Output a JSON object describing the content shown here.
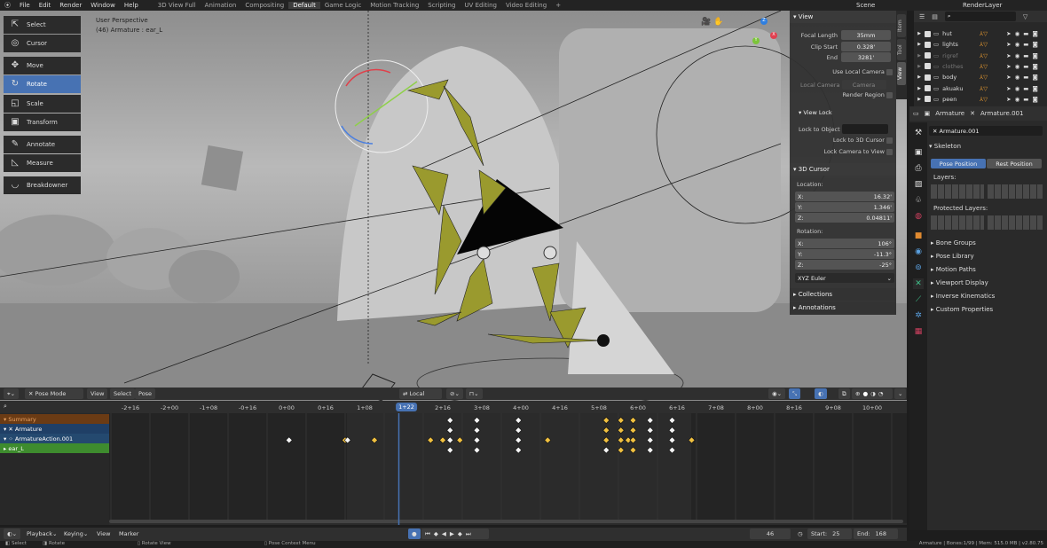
{
  "menu": {
    "items": [
      "File",
      "Edit",
      "Render",
      "Window",
      "Help"
    ],
    "workspaces": [
      "3D View Full",
      "Animation",
      "Compositing",
      "Default",
      "Game Logic",
      "Motion Tracking",
      "Scripting",
      "UV Editing",
      "Video Editing"
    ],
    "active_workspace": "Default",
    "add": "+",
    "scene": "Scene",
    "render_layer": "RenderLayer"
  },
  "toolbar": {
    "tools": [
      {
        "label": "Select",
        "icon": "select-icon"
      },
      {
        "label": "Cursor",
        "icon": "cursor-icon"
      },
      {
        "label": "Move",
        "icon": "move-icon"
      },
      {
        "label": "Rotate",
        "icon": "rotate-icon",
        "active": true
      },
      {
        "label": "Scale",
        "icon": "scale-icon"
      },
      {
        "label": "Transform",
        "icon": "transform-icon"
      },
      {
        "label": "Annotate",
        "icon": "annotate-icon"
      },
      {
        "label": "Measure",
        "icon": "measure-icon"
      },
      {
        "label": "Breakdowner",
        "icon": "breakdowner-icon"
      }
    ]
  },
  "viewport": {
    "perspective": "User Perspective",
    "object": "(46) Armature : ear_L",
    "gizmo": {
      "x": "X",
      "y": "Y",
      "z": "Z"
    }
  },
  "npanel": {
    "tabs": [
      "Item",
      "Tool",
      "View"
    ],
    "active_tab": "View",
    "view": {
      "title": "View",
      "focal_length_label": "Focal Length",
      "focal_length": "35mm",
      "clip_start_label": "Clip Start",
      "clip_start": "0.328'",
      "end_label": "End",
      "end": "3281'",
      "use_local_camera": "Use Local Camera",
      "local_camera_label": "Local Camera",
      "local_camera": "Camera",
      "render_region": "Render Region"
    },
    "view_lock": {
      "title": "View Lock",
      "lock_to_object": "Lock to Object",
      "lock_to_cursor": "Lock to 3D Cursor",
      "lock_camera": "Lock Camera to View"
    },
    "cursor": {
      "title": "3D Cursor",
      "location": "Location:",
      "loc": [
        {
          "axis": "X:",
          "value": "16.32'"
        },
        {
          "axis": "Y:",
          "value": "1.346'"
        },
        {
          "axis": "Z:",
          "value": "0.04811'"
        }
      ],
      "rotation": "Rotation:",
      "rot": [
        {
          "axis": "X:",
          "value": "106°"
        },
        {
          "axis": "Y:",
          "value": "-11.3°"
        },
        {
          "axis": "Z:",
          "value": "-25°"
        }
      ],
      "mode": "XYZ Euler"
    },
    "collections": "Collections",
    "annotations": "Annotations"
  },
  "outliner": {
    "rows": [
      {
        "name": "hut",
        "dim": false
      },
      {
        "name": "lights",
        "dim": false
      },
      {
        "name": "rigref",
        "dim": true
      },
      {
        "name": "clothes",
        "dim": true
      },
      {
        "name": "body",
        "dim": false
      },
      {
        "name": "akuaku",
        "dim": false
      },
      {
        "name": "peen",
        "dim": false
      }
    ]
  },
  "properties": {
    "context": "Armature",
    "data": "Armature.001",
    "datablock": "Armature.001",
    "skeleton": "Skeleton",
    "pose_position": "Pose Position",
    "rest_position": "Rest Position",
    "layers": "Layers:",
    "protected_layers": "Protected Layers:",
    "sections": [
      "Bone Groups",
      "Pose Library",
      "Motion Paths",
      "Viewport Display",
      "Inverse Kinematics",
      "Custom Properties"
    ]
  },
  "viewport_header": {
    "mode": "Pose Mode",
    "menus": [
      "View",
      "Select",
      "Pose"
    ],
    "orientation": "Local"
  },
  "dopesheet": {
    "ticks": [
      "-2+16",
      "-2+00",
      "-1+08",
      "-0+16",
      "0+00",
      "0+16",
      "1+08",
      "1+22",
      "2+16",
      "3+08",
      "4+00",
      "4+16",
      "5+08",
      "6+00",
      "6+16",
      "7+08",
      "8+00",
      "8+16",
      "9+08",
      "10+00"
    ],
    "current": "1+22",
    "channels": [
      {
        "name": "Summary",
        "color": "#6b3b14"
      },
      {
        "name": "Armature",
        "color": "#1f3f66"
      },
      {
        "name": "ArmatureAction.001",
        "color": "#24496f"
      },
      {
        "name": "ear_L",
        "color": "#3e8c2e"
      }
    ],
    "keyframes": [
      {
        "row": 0,
        "frames": [
          67,
          78,
          95,
          131,
          137,
          142,
          149,
          158
        ],
        "selected": [
          131,
          137,
          142
        ]
      },
      {
        "row": 1,
        "frames": [
          67,
          78,
          95,
          131,
          137,
          142,
          149,
          158
        ],
        "selected": [
          131,
          137,
          142
        ]
      },
      {
        "row": 2,
        "frames": [
          1,
          24,
          25,
          36,
          59,
          64,
          67,
          71,
          78,
          95,
          107,
          131,
          137,
          140,
          142,
          149,
          158,
          166
        ],
        "selected": [
          24,
          36,
          59,
          64,
          71,
          107,
          131,
          137,
          140,
          142,
          166
        ]
      },
      {
        "row": 3,
        "frames": [
          67,
          78,
          95,
          131,
          137,
          142,
          149,
          158
        ],
        "selected": [
          137,
          142
        ]
      }
    ]
  },
  "timeline": {
    "menus": [
      "Playback",
      "Keying",
      "View",
      "Marker"
    ],
    "current_frame": "46",
    "start_label": "Start:",
    "start": "25",
    "end_label": "End:",
    "end": "168"
  },
  "status": {
    "select": "Select",
    "rotate": "Rotate",
    "rotate_view": "Rotate View",
    "context_menu": "Pose Context Menu",
    "info": "Armature | Bones:1/99 | Mem: 515.0 MB | v2.80.75"
  }
}
